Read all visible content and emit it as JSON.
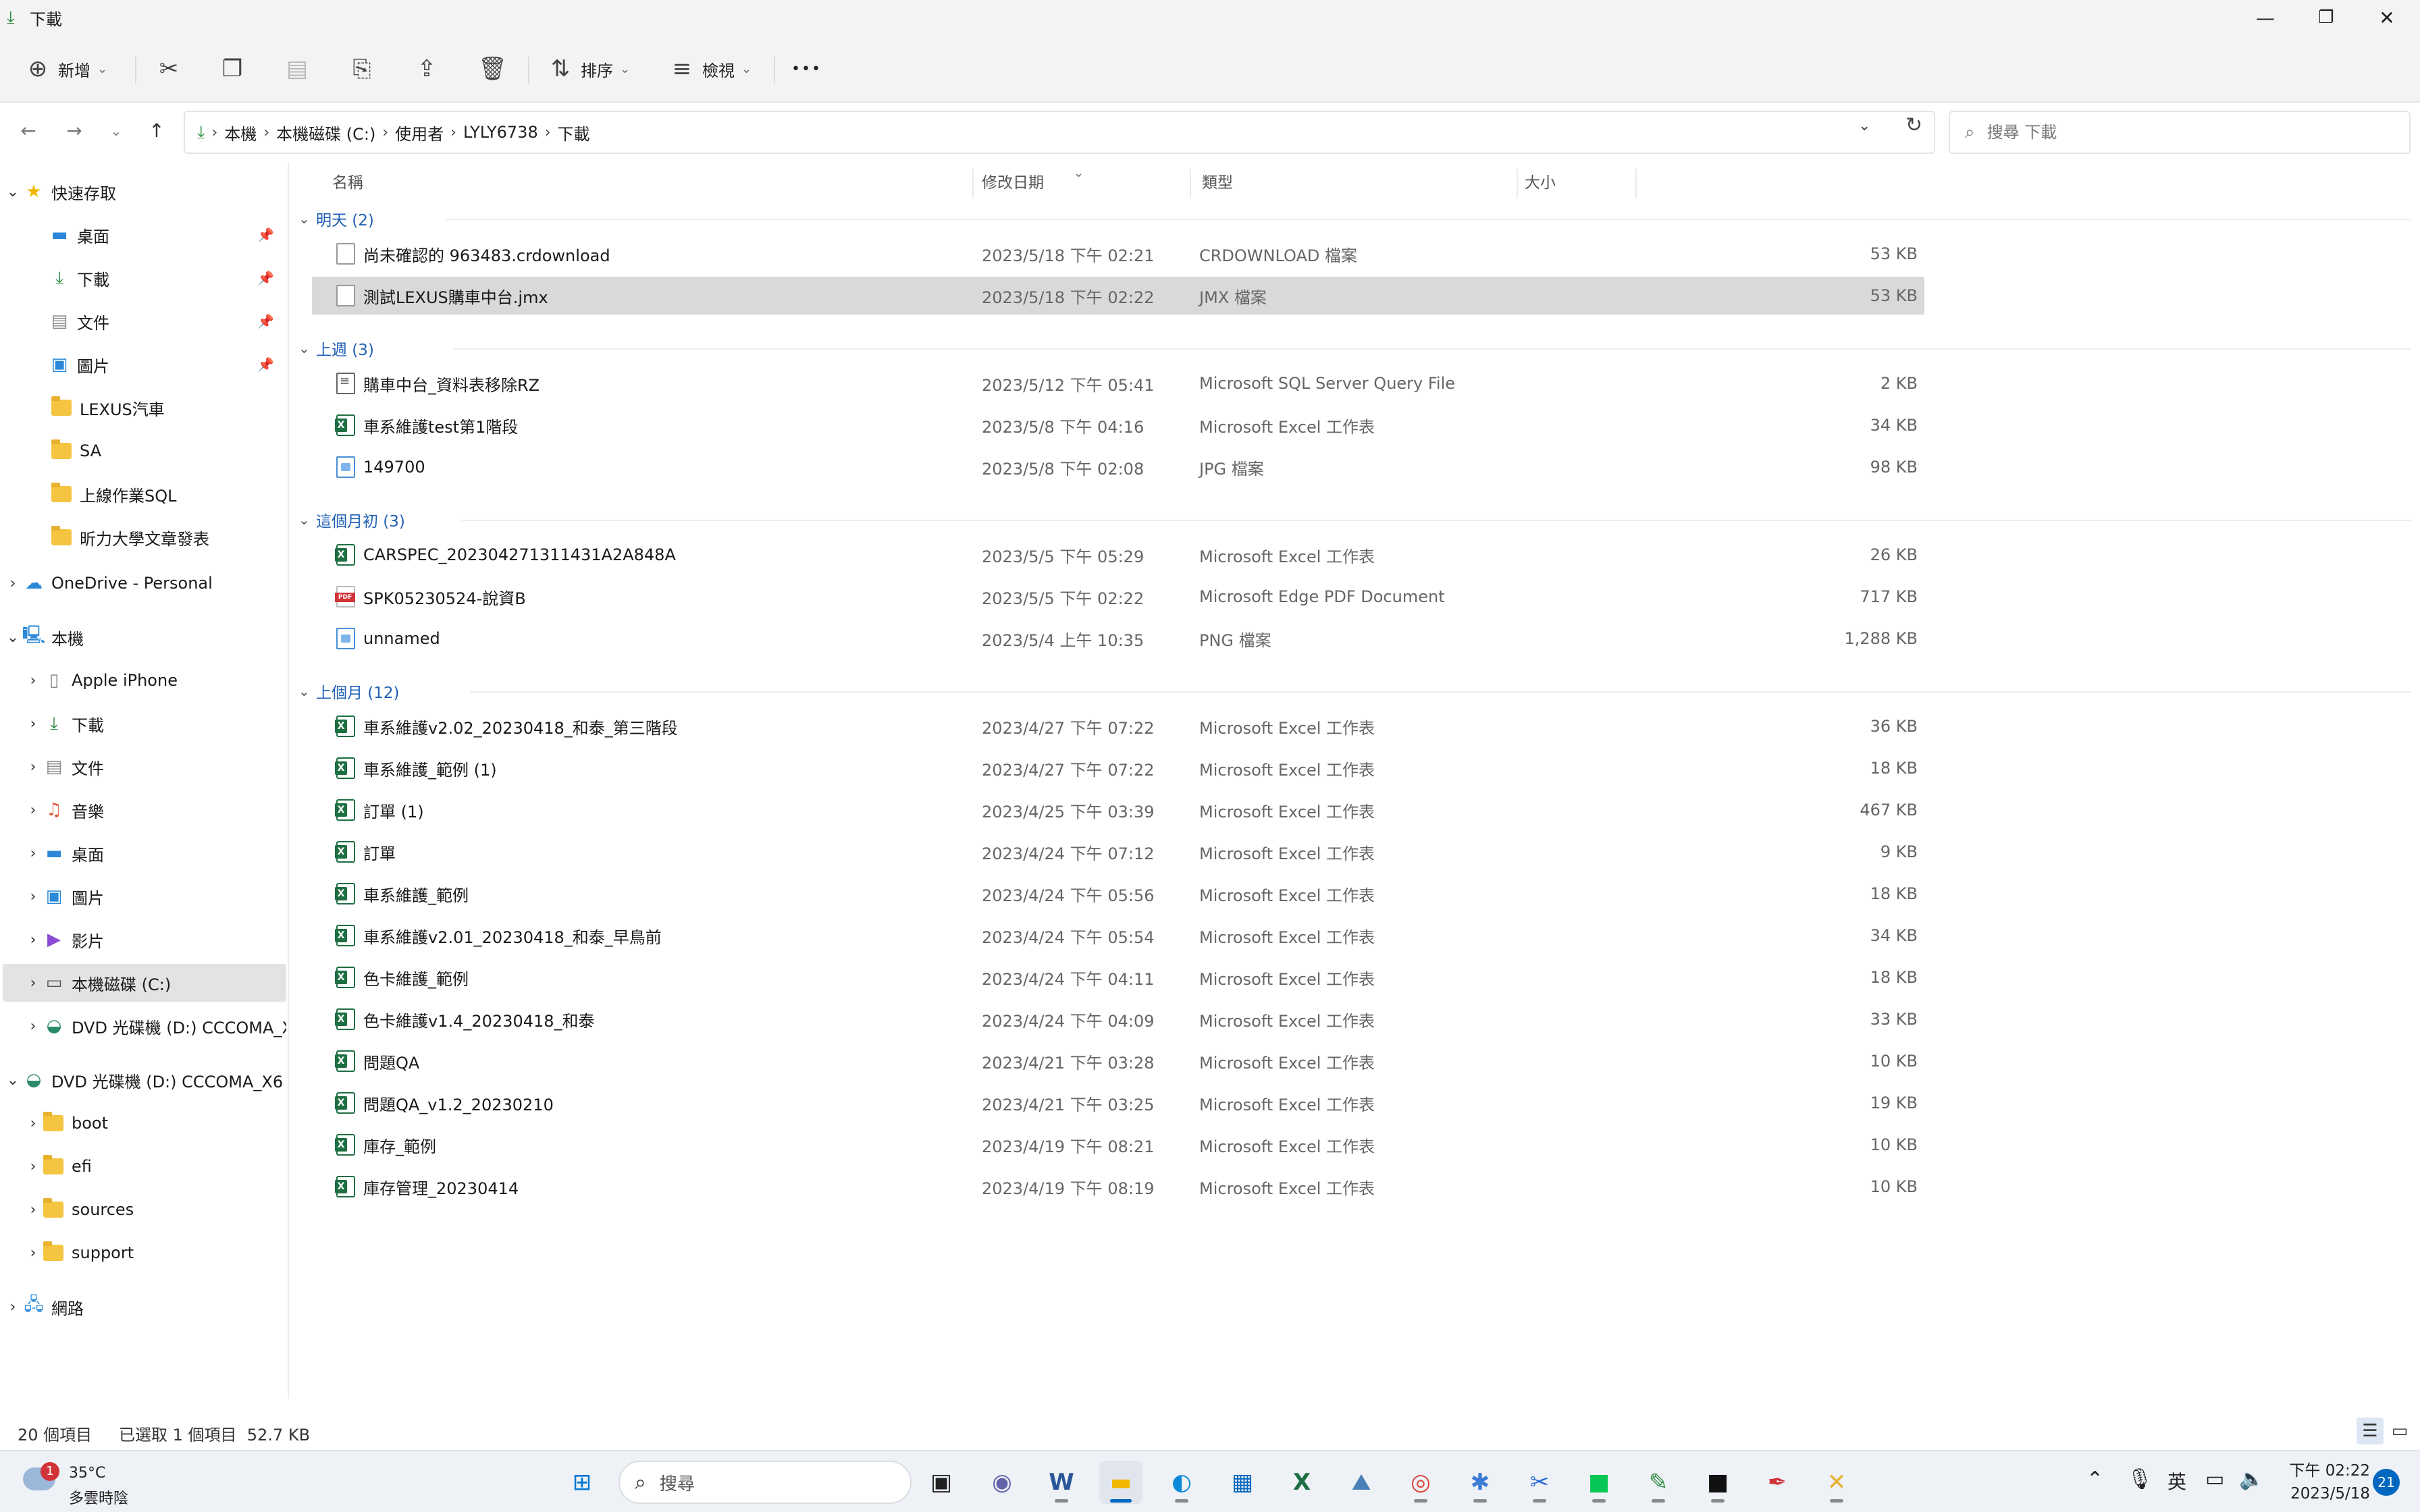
{
  "window": {
    "title": "下載",
    "icons": {
      "title": "download-icon",
      "minimize": "minimize-icon",
      "restore": "restore-icon",
      "close": "close-icon"
    }
  },
  "toolbar": {
    "new_label": "新增",
    "sort_label": "排序",
    "view_label": "檢視",
    "more_label": "•••"
  },
  "breadcrumb": [
    "本機",
    "本機磁碟 (C:)",
    "使用者",
    "LYLY6738",
    "下載"
  ],
  "search": {
    "placeholder": "搜尋 下載"
  },
  "sidebar": {
    "quick_access": {
      "label": "快速存取",
      "items": [
        {
          "label": "桌面",
          "pinned": true,
          "icon": "desktop-icon"
        },
        {
          "label": "下載",
          "pinned": true,
          "icon": "download-icon"
        },
        {
          "label": "文件",
          "pinned": true,
          "icon": "documents-icon"
        },
        {
          "label": "圖片",
          "pinned": true,
          "icon": "pictures-icon"
        },
        {
          "label": "LEXUS汽車",
          "pinned": false,
          "icon": "folder-icon"
        },
        {
          "label": "SA",
          "pinned": false,
          "icon": "sync-folder-icon"
        },
        {
          "label": "上線作業SQL",
          "pinned": false,
          "icon": "sync-folder-icon"
        },
        {
          "label": "昕力大學文章發表",
          "pinned": false,
          "icon": "folder-icon"
        }
      ]
    },
    "onedrive": {
      "label": "OneDrive - Personal"
    },
    "this_pc": {
      "label": "本機",
      "items": [
        {
          "label": "Apple iPhone",
          "icon": "phone-icon"
        },
        {
          "label": "下載",
          "icon": "download-icon"
        },
        {
          "label": "文件",
          "icon": "documents-icon"
        },
        {
          "label": "音樂",
          "icon": "music-icon"
        },
        {
          "label": "桌面",
          "icon": "desktop-icon"
        },
        {
          "label": "圖片",
          "icon": "pictures-icon"
        },
        {
          "label": "影片",
          "icon": "videos-icon"
        },
        {
          "label": "本機磁碟 (C:)",
          "icon": "drive-icon"
        },
        {
          "label": "DVD 光碟機 (D:) CCCOMA_X",
          "icon": "dvd-icon"
        }
      ]
    },
    "dvd": {
      "label": "DVD 光碟機 (D:) CCCOMA_X6",
      "items": [
        "boot",
        "efi",
        "sources",
        "support"
      ]
    },
    "network": {
      "label": "網路"
    }
  },
  "columns": {
    "name": "名稱",
    "date": "修改日期",
    "type": "類型",
    "size": "大小"
  },
  "groups": [
    {
      "label": "明天 (2)",
      "files": [
        {
          "name": "尚未確認的 963483.crdownload",
          "date": "2023/5/18 下午 02:21",
          "type": "CRDOWNLOAD 檔案",
          "size": "53 KB",
          "icon": "doc"
        },
        {
          "name": "測試LEXUS購車中台.jmx",
          "date": "2023/5/18 下午 02:22",
          "type": "JMX 檔案",
          "size": "53 KB",
          "icon": "doc",
          "selected": true
        }
      ]
    },
    {
      "label": "上週 (3)",
      "files": [
        {
          "name": "購車中台_資料表移除RZ",
          "date": "2023/5/12 下午 05:41",
          "type": "Microsoft SQL Server Query File",
          "size": "2 KB",
          "icon": "sql"
        },
        {
          "name": "車系維護test第1階段",
          "date": "2023/5/8 下午 04:16",
          "type": "Microsoft Excel 工作表",
          "size": "34 KB",
          "icon": "xl"
        },
        {
          "name": "149700",
          "date": "2023/5/8 下午 02:08",
          "type": "JPG 檔案",
          "size": "98 KB",
          "icon": "img"
        }
      ]
    },
    {
      "label": "這個月初 (3)",
      "files": [
        {
          "name": "CARSPEC_202304271311431A2A848A",
          "date": "2023/5/5 下午 05:29",
          "type": "Microsoft Excel 工作表",
          "size": "26 KB",
          "icon": "xl"
        },
        {
          "name": "SPK05230524-說資B",
          "date": "2023/5/5 下午 02:22",
          "type": "Microsoft Edge PDF Document",
          "size": "717 KB",
          "icon": "pdf"
        },
        {
          "name": "unnamed",
          "date": "2023/5/4 上午 10:35",
          "type": "PNG 檔案",
          "size": "1,288 KB",
          "icon": "img"
        }
      ]
    },
    {
      "label": "上個月 (12)",
      "files": [
        {
          "name": "車系維護v2.02_20230418_和泰_第三階段",
          "date": "2023/4/27 下午 07:22",
          "type": "Microsoft Excel 工作表",
          "size": "36 KB",
          "icon": "xl"
        },
        {
          "name": "車系維護_範例 (1)",
          "date": "2023/4/27 下午 07:22",
          "type": "Microsoft Excel 工作表",
          "size": "18 KB",
          "icon": "xl"
        },
        {
          "name": "訂單 (1)",
          "date": "2023/4/25 下午 03:39",
          "type": "Microsoft Excel 工作表",
          "size": "467 KB",
          "icon": "xl"
        },
        {
          "name": "訂單",
          "date": "2023/4/24 下午 07:12",
          "type": "Microsoft Excel 工作表",
          "size": "9 KB",
          "icon": "xl"
        },
        {
          "name": "車系維護_範例",
          "date": "2023/4/24 下午 05:56",
          "type": "Microsoft Excel 工作表",
          "size": "18 KB",
          "icon": "xl"
        },
        {
          "name": "車系維護v2.01_20230418_和泰_早鳥前",
          "date": "2023/4/24 下午 05:54",
          "type": "Microsoft Excel 工作表",
          "size": "34 KB",
          "icon": "xl"
        },
        {
          "name": "色卡維護_範例",
          "date": "2023/4/24 下午 04:11",
          "type": "Microsoft Excel 工作表",
          "size": "18 KB",
          "icon": "xl"
        },
        {
          "name": "色卡維護v1.4_20230418_和泰",
          "date": "2023/4/24 下午 04:09",
          "type": "Microsoft Excel 工作表",
          "size": "33 KB",
          "icon": "xl"
        },
        {
          "name": "問題QA",
          "date": "2023/4/21 下午 03:28",
          "type": "Microsoft Excel 工作表",
          "size": "10 KB",
          "icon": "xl"
        },
        {
          "name": "問題QA_v1.2_20230210",
          "date": "2023/4/21 下午 03:25",
          "type": "Microsoft Excel 工作表",
          "size": "19 KB",
          "icon": "xl"
        },
        {
          "name": "庫存_範例",
          "date": "2023/4/19 下午 08:21",
          "type": "Microsoft Excel 工作表",
          "size": "10 KB",
          "icon": "xl"
        },
        {
          "name": "庫存管理_20230414",
          "date": "2023/4/19 下午 08:19",
          "type": "Microsoft Excel 工作表",
          "size": "10 KB",
          "icon": "xl"
        }
      ]
    }
  ],
  "status": {
    "item_count": "20 個項目",
    "selection": "已選取 1 個項目  52.7 KB"
  },
  "taskbar": {
    "weather_temp": "35°C",
    "weather_cond": "多雲時陰",
    "weather_badge": "1",
    "search_label": "搜尋",
    "ime_label": "英",
    "time": "下午 02:22",
    "date": "2023/5/18",
    "notification_count": "21"
  },
  "colors": {
    "accent": "#0067c0",
    "group_header": "#1f5fb4",
    "selected_row": "#d9d9d9",
    "excel": "#1d6f42"
  }
}
